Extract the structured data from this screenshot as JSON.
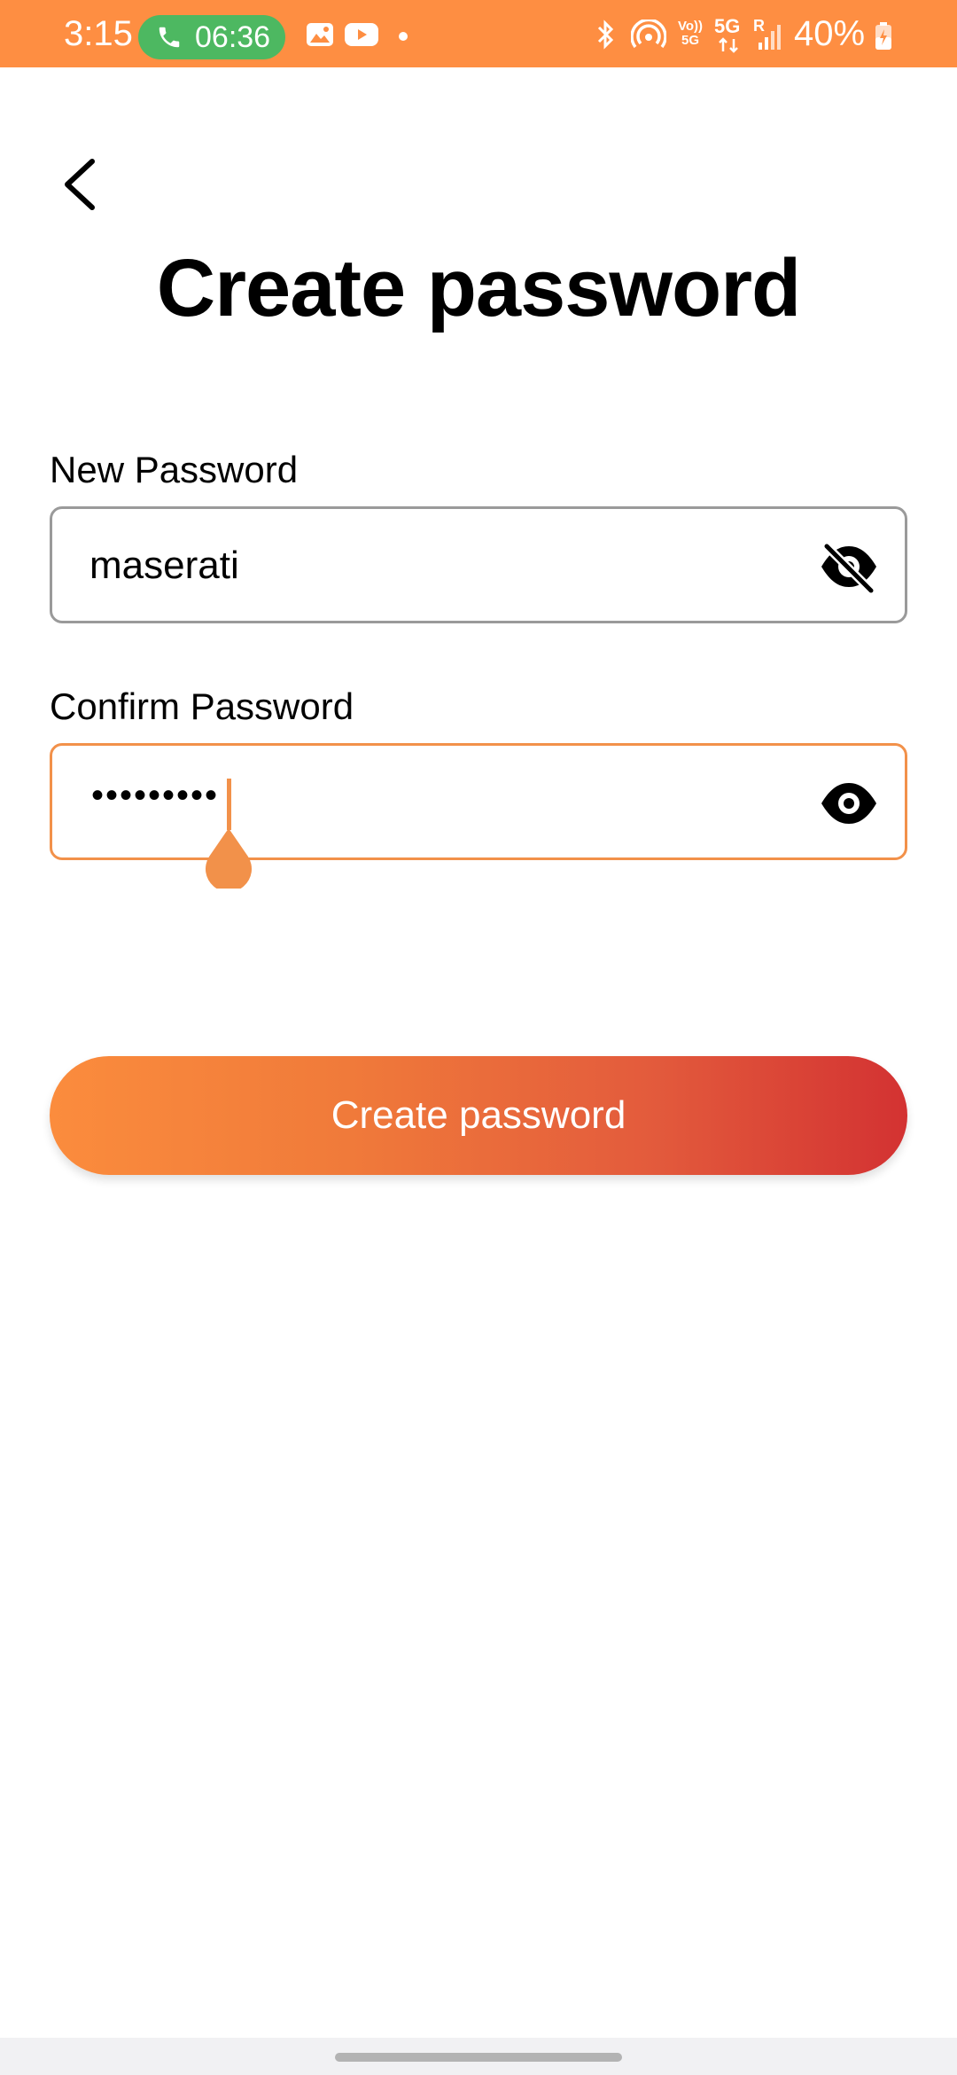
{
  "status_bar": {
    "time": "3:15",
    "call_time": "06:36",
    "battery": "40%",
    "volte_label": "Vo)) 5G",
    "net_label": "5G",
    "signal_label": "R",
    "icons": [
      "phone-icon",
      "gallery-icon",
      "youtube-icon",
      "bluetooth-icon",
      "hotspot-icon",
      "volte-icon",
      "5g-icon",
      "signal-icon",
      "battery-icon"
    ]
  },
  "header": {
    "title": "Create password",
    "back_icon": "chevron-left-icon"
  },
  "form": {
    "new_password": {
      "label": "New Password",
      "value": "maserati",
      "toggle_icon": "eye-off-icon"
    },
    "confirm_password": {
      "label": "Confirm Password",
      "masked_value": "•••••••••",
      "toggle_icon": "eye-icon"
    }
  },
  "actions": {
    "submit_label": "Create password"
  },
  "colors": {
    "accent": "#FE8E42",
    "gradient_start": "#FB8C3D",
    "gradient_end": "#D33232",
    "call_pill": "#4DB861"
  }
}
